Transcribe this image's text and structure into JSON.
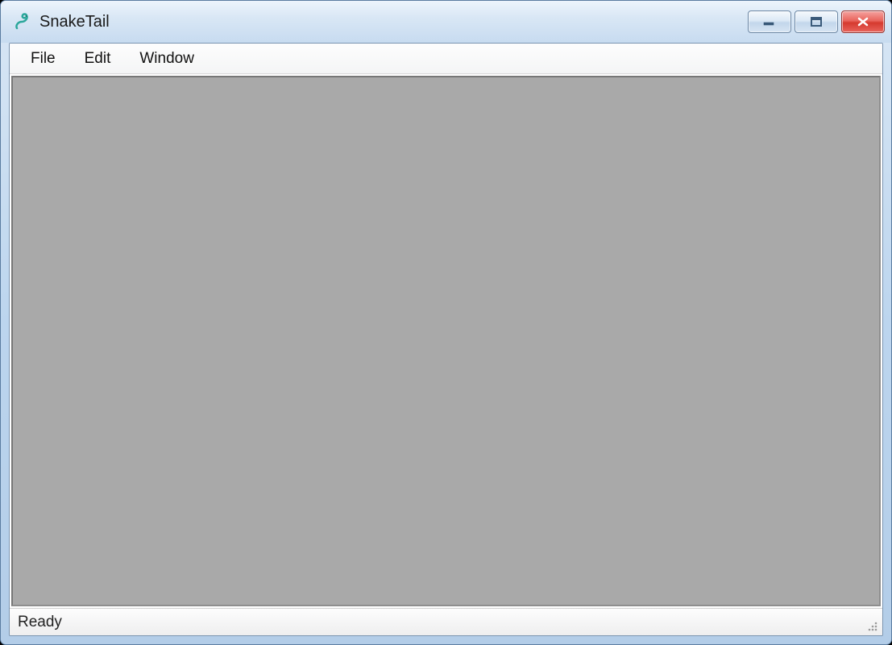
{
  "window": {
    "title": "SnakeTail"
  },
  "menubar": {
    "items": [
      {
        "label": "File"
      },
      {
        "label": "Edit"
      },
      {
        "label": "Window"
      }
    ]
  },
  "statusbar": {
    "text": "Ready"
  }
}
